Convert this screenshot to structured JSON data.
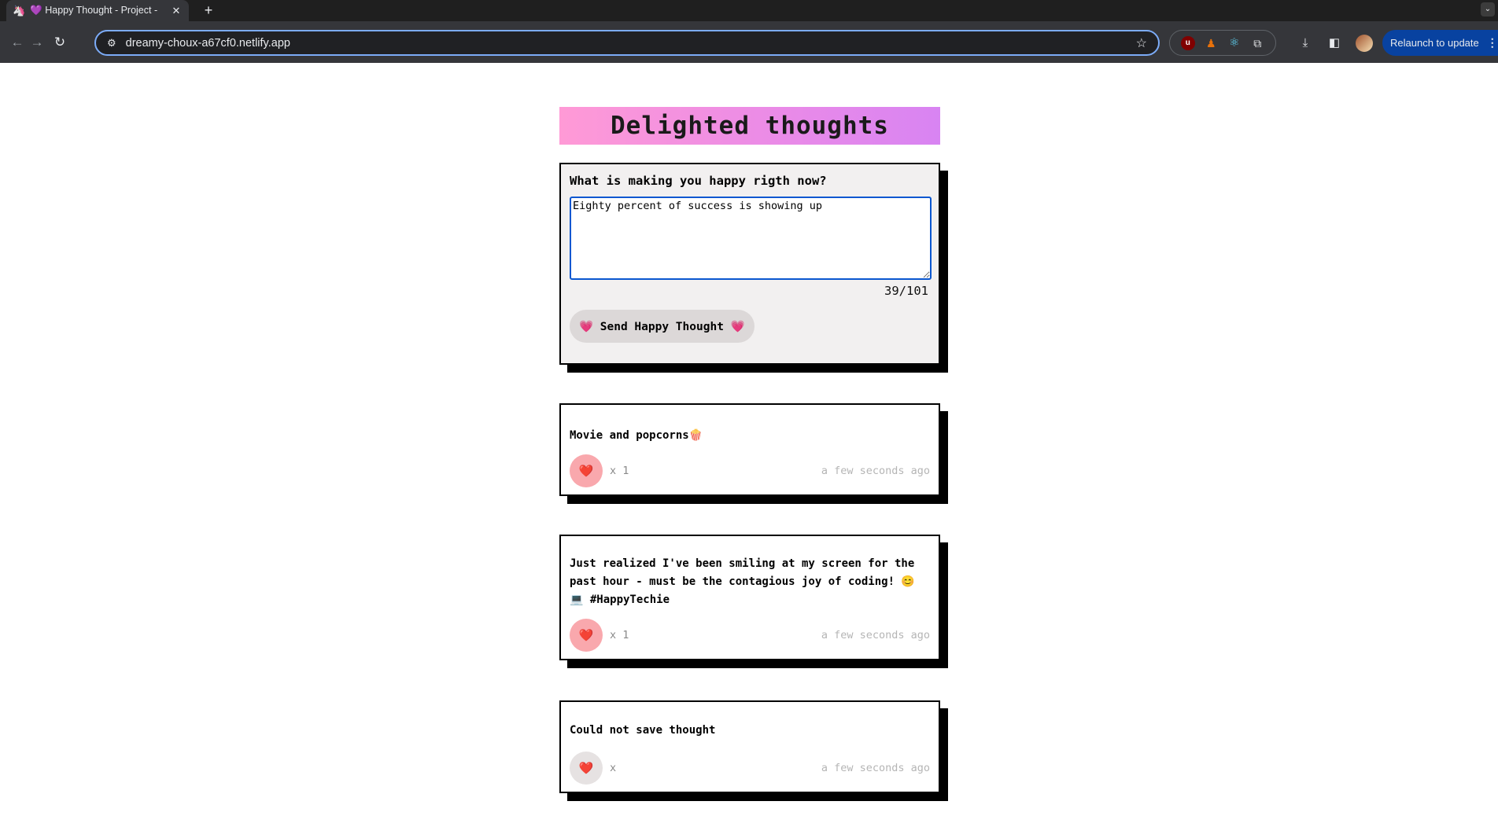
{
  "browser": {
    "tab_title": "💜 Happy Thought - Project -",
    "tab_favicon": "🦄",
    "url": "dreamy-choux-a67cf0.netlify.app",
    "relaunch_label": "Relaunch to update",
    "icons": [
      "back-icon",
      "forward-icon",
      "reload-icon",
      "tune-icon",
      "star-icon",
      "ublock-icon",
      "fox-extension-icon",
      "react-devtools-icon",
      "puzzle-icon",
      "download-icon",
      "sidepanel-icon",
      "avatar"
    ]
  },
  "header": {
    "title": "Delighted thoughts"
  },
  "form": {
    "question": "What is making you happy rigth now?",
    "input_value": "Eighty percent of success is showing up",
    "char_count": "39/101",
    "send_label": "💗 Send Happy Thought 💗"
  },
  "thoughts": [
    {
      "text": "Movie and popcorns🍿",
      "likes": "x 1",
      "time": "a few seconds ago",
      "heart_color": "#f9a8ad"
    },
    {
      "text": "Just realized I've been smiling at my screen for the past hour - must be the contagious joy of coding! 😊 💻 #HappyTechie",
      "likes": "x 1",
      "time": "a few seconds ago",
      "heart_color": "#f9a8ad"
    },
    {
      "text": "Could not save thought",
      "likes": "x",
      "time": "a few seconds ago",
      "heart_color": "#e6e2e2"
    }
  ],
  "colors": {
    "header_gradient_start": "#ff9ad6",
    "header_gradient_end": "#d884f2",
    "card_shadow": "#000000",
    "form_background": "#f2f0f0",
    "heart_active": "#f9a8ad"
  }
}
